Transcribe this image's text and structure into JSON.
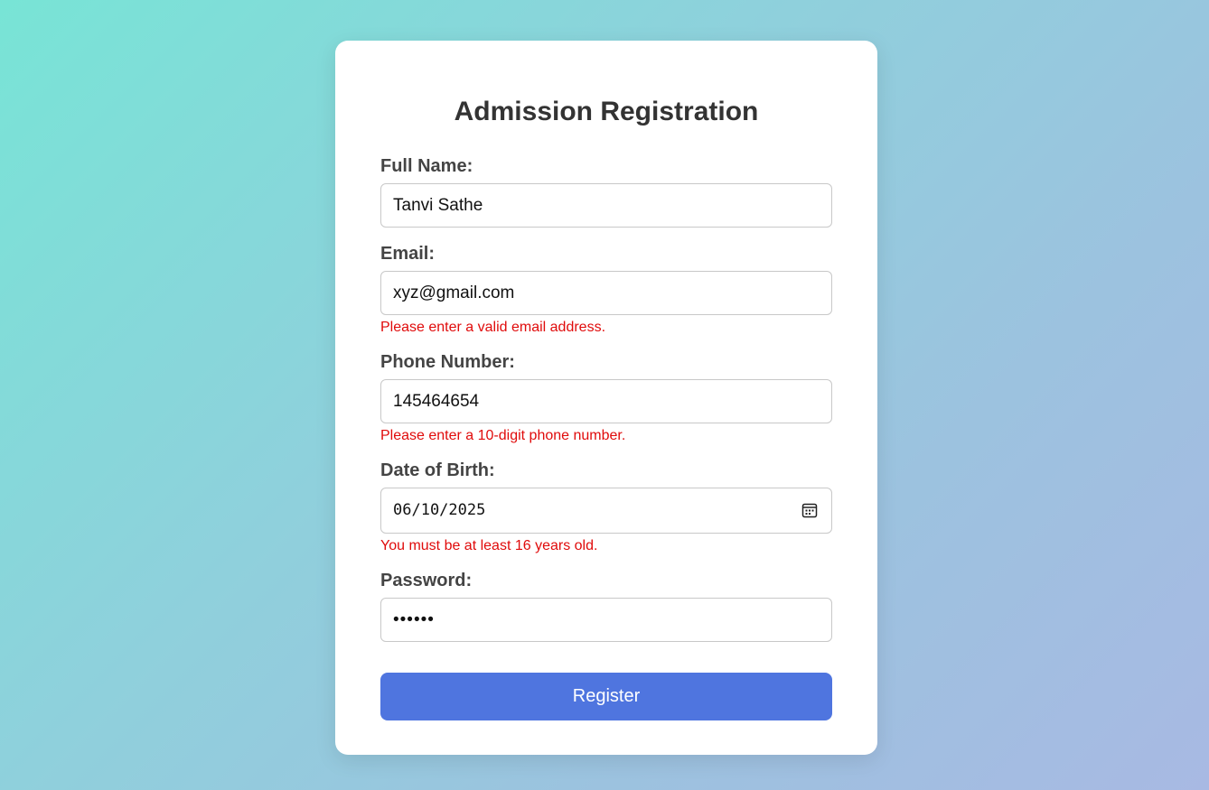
{
  "form": {
    "title": "Admission Registration",
    "full_name": {
      "label": "Full Name:",
      "value": "Tanvi Sathe"
    },
    "email": {
      "label": "Email:",
      "value": "xyz@gmail.com",
      "error": "Please enter a valid email address."
    },
    "phone": {
      "label": "Phone Number:",
      "value": "145464654",
      "error": "Please enter a 10-digit phone number."
    },
    "dob": {
      "label": "Date of Birth:",
      "value": "06/10/2025",
      "error": "You must be at least 16 years old.",
      "icon": "calendar-icon"
    },
    "password": {
      "label": "Password:",
      "value": "••••••"
    },
    "submit_label": "Register"
  },
  "colors": {
    "accent": "#4f75df",
    "error": "#e00b0b",
    "background_start": "#78e4d6",
    "background_end": "#a8b9e3"
  }
}
